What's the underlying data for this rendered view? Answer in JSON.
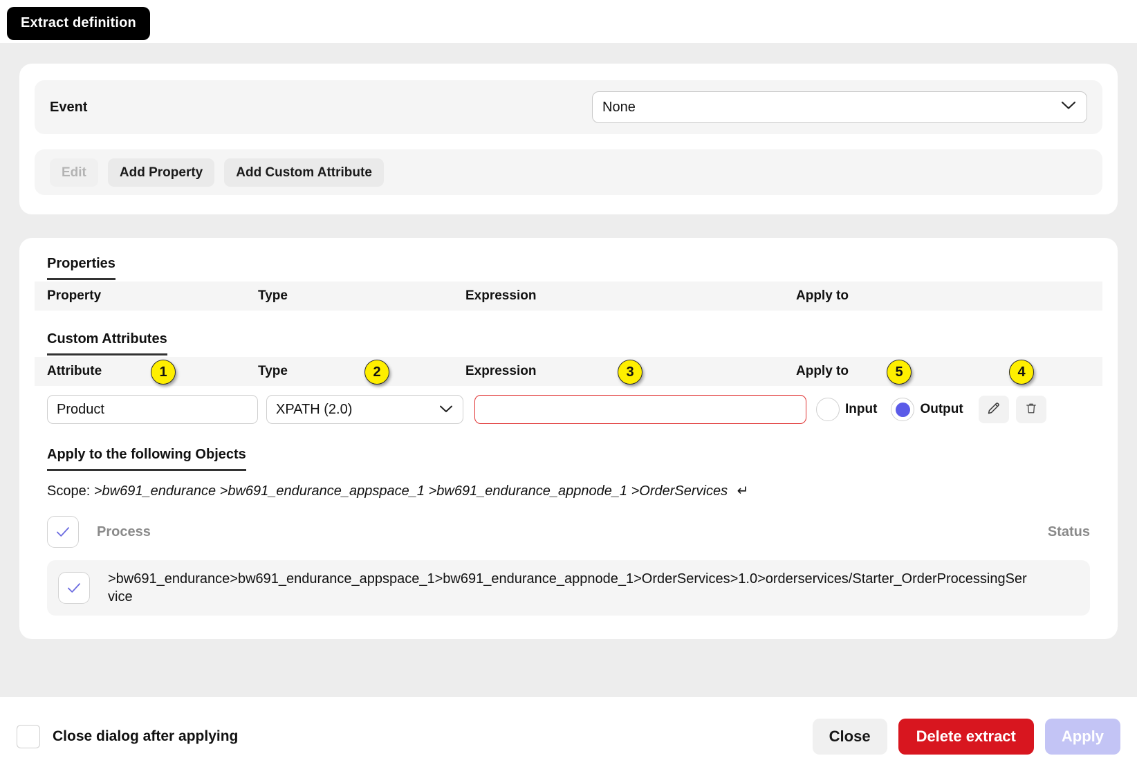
{
  "title_chip": {
    "label": "Extract definition"
  },
  "event_section": {
    "label": "Event",
    "select_value": "None",
    "chevron_icon": "chevron-down-icon",
    "buttons": [
      {
        "label": "Edit",
        "disabled": true
      },
      {
        "label": "Add Property",
        "disabled": false
      },
      {
        "label": "Add Custom Attribute",
        "disabled": false
      }
    ]
  },
  "properties_section": {
    "heading": "Properties",
    "columns": [
      "Property",
      "Type",
      "Expression",
      "Apply to"
    ],
    "rows": []
  },
  "custom_attributes_section": {
    "heading": "Custom Attributes",
    "columns": [
      "Attribute",
      "Type",
      "Expression",
      "Apply to"
    ],
    "row": {
      "attribute_value": "Product",
      "type_value": "XPATH (2.0)",
      "type_chevron_icon": "chevron-down-icon",
      "expression_value": "",
      "expression_placeholder": "",
      "apply_to_input_label": "Input",
      "apply_to_output_label": "Output",
      "apply_to_selected": "Output",
      "edit_icon": "pencil-icon",
      "delete_icon": "trash-icon"
    }
  },
  "badges": [
    {
      "number": "1"
    },
    {
      "number": "2"
    },
    {
      "number": "3"
    },
    {
      "number": "4"
    },
    {
      "number": "5"
    }
  ],
  "apply_objects_section": {
    "heading": "Apply to the following Objects",
    "scope_prefix": "Scope: ",
    "scope_path": ">bw691_endurance >bw691_endurance_appspace_1 >bw691_endurance_appnode_1 >OrderServices",
    "scope_return_icon": "return-arrow-icon",
    "process_column": "Process",
    "status_column": "Status",
    "rows": [
      {
        "checked": true,
        "path": ">bw691_endurance>bw691_endurance_appspace_1>bw691_endurance_appnode_1>OrderServices>1.0>orderservices/Starter_OrderProcessingService"
      }
    ],
    "header_checked": true,
    "check_icon": "check-icon"
  },
  "footer": {
    "checkbox_label": "Close dialog after applying",
    "checkbox_checked": false,
    "close_label": "Close",
    "delete_label": "Delete extract",
    "apply_label": "Apply"
  },
  "colors": {
    "backdrop": "#ededed",
    "panel": "#ffffff",
    "badge_yellow": "#ffef00",
    "radio_blue": "#5b5be8",
    "danger_red": "#d8161f",
    "apply_disabled": "#c3c4f5",
    "error_border": "#e03131"
  }
}
